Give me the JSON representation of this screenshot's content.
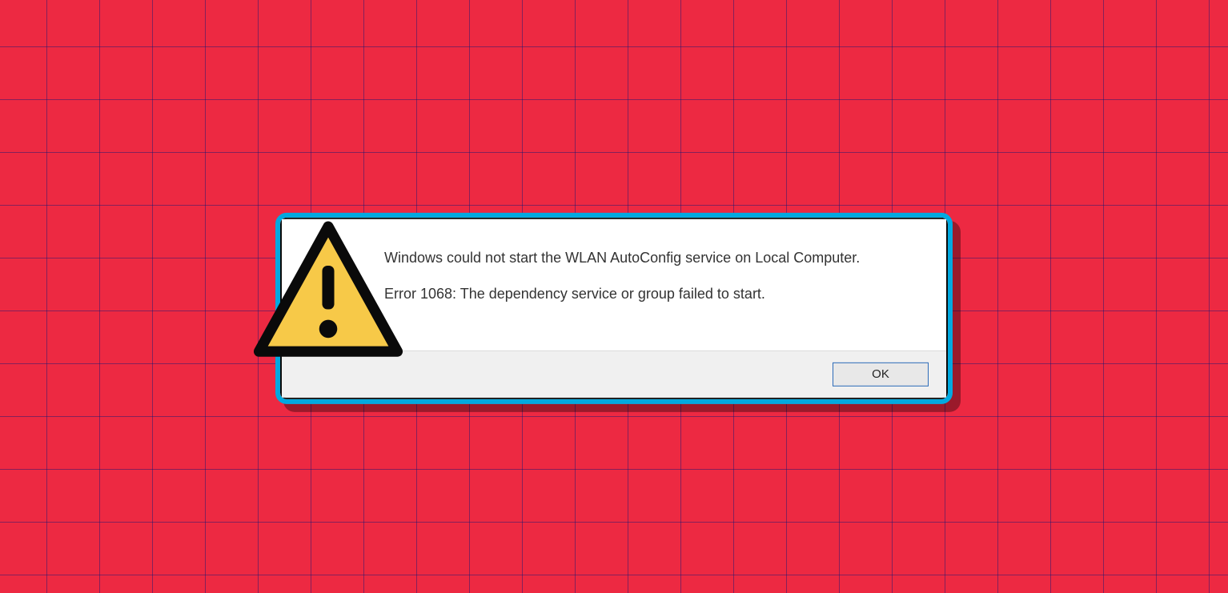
{
  "dialog": {
    "message_line_1": "Windows could not start the WLAN AutoConfig service on Local Computer.",
    "message_line_2": "Error 1068: The dependency service or group failed to start.",
    "ok_label": "OK",
    "icon_name": "warning-triangle"
  },
  "colors": {
    "background": "#ed2942",
    "grid_line": "rgba(10,20,120,0.45)",
    "dialog_border": "#00a9e0",
    "icon_fill": "#f7c948",
    "icon_stroke": "#0a0a0a"
  }
}
